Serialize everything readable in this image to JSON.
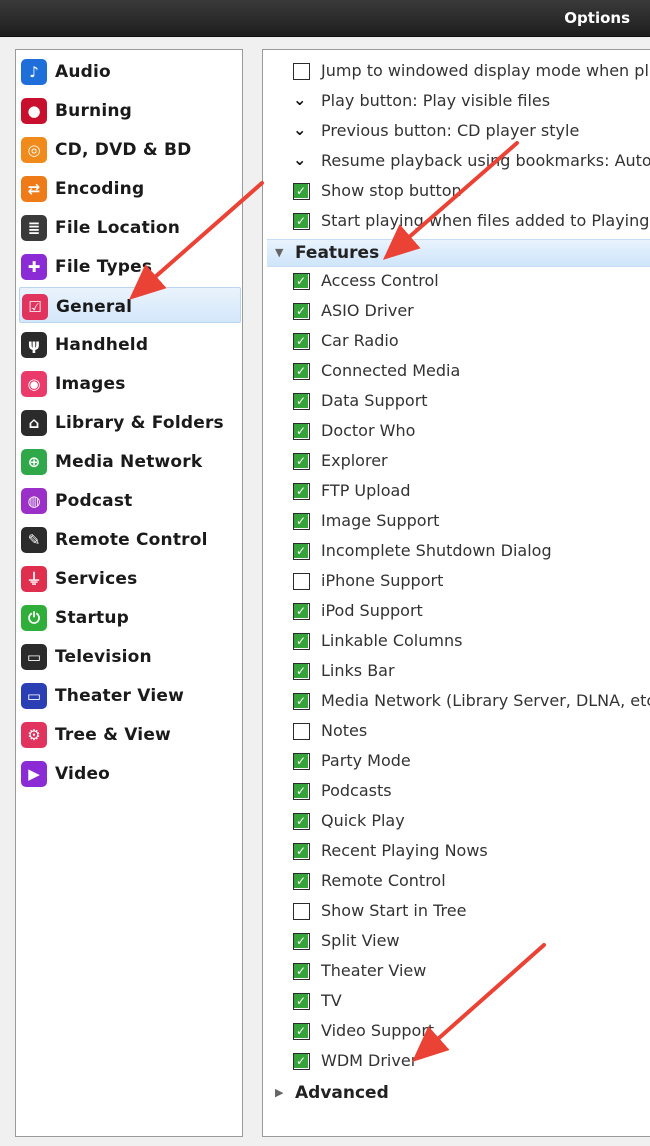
{
  "window": {
    "title": "Options"
  },
  "sidebar": {
    "selected": "General",
    "items": [
      {
        "label": "Audio",
        "icon": "music-note-icon",
        "color": "#1e6fd9",
        "glyph": "♪"
      },
      {
        "label": "Burning",
        "icon": "burn-disc-icon",
        "color": "#c8102e",
        "glyph": "●"
      },
      {
        "label": "CD, DVD & BD",
        "icon": "disc-icon",
        "color": "#f08a1a",
        "glyph": "◎"
      },
      {
        "label": "Encoding",
        "icon": "encoding-icon",
        "color": "#ef7a18",
        "glyph": "⇄"
      },
      {
        "label": "File Location",
        "icon": "file-location-icon",
        "color": "#3a3a3a",
        "glyph": "≣"
      },
      {
        "label": "File Types",
        "icon": "puzzle-icon",
        "color": "#8a2bd6",
        "glyph": "✚"
      },
      {
        "label": "General",
        "icon": "general-checkbox-icon",
        "color": "#e0335d",
        "glyph": "☑"
      },
      {
        "label": "Handheld",
        "icon": "usb-icon",
        "color": "#2b2b2b",
        "glyph": "ψ"
      },
      {
        "label": "Images",
        "icon": "camera-icon",
        "color": "#ea3a6a",
        "glyph": "◉"
      },
      {
        "label": "Library & Folders",
        "icon": "library-icon",
        "color": "#2b2b2b",
        "glyph": "⌂"
      },
      {
        "label": "Media Network",
        "icon": "network-icon",
        "color": "#2fa84a",
        "glyph": "⊕"
      },
      {
        "label": "Podcast",
        "icon": "podcast-icon",
        "color": "#9b30c9",
        "glyph": "◍"
      },
      {
        "label": "Remote Control",
        "icon": "remote-icon",
        "color": "#2b2b2b",
        "glyph": "✎"
      },
      {
        "label": "Services",
        "icon": "plug-icon",
        "color": "#e02e4f",
        "glyph": "⏚"
      },
      {
        "label": "Startup",
        "icon": "power-icon",
        "color": "#2fae3a",
        "glyph": "⏻"
      },
      {
        "label": "Television",
        "icon": "tv-icon",
        "color": "#2b2b2b",
        "glyph": "▭"
      },
      {
        "label": "Theater View",
        "icon": "monitor-icon",
        "color": "#2a3fb3",
        "glyph": "▭"
      },
      {
        "label": "Tree & View",
        "icon": "gear-icon",
        "color": "#e0335d",
        "glyph": "⚙"
      },
      {
        "label": "Video",
        "icon": "video-camera-icon",
        "color": "#8a2bd6",
        "glyph": "▶"
      }
    ]
  },
  "content": {
    "top_rows": [
      {
        "type": "checkbox",
        "checked": false,
        "label": "Jump to windowed display mode when pl"
      },
      {
        "type": "dropdown",
        "label": "Play button: Play visible files"
      },
      {
        "type": "dropdown",
        "label": "Previous button: CD player style"
      },
      {
        "type": "dropdown",
        "label": "Resume playback using bookmarks: Autor"
      },
      {
        "type": "checkbox",
        "checked": true,
        "label": "Show stop button"
      },
      {
        "type": "checkbox",
        "checked": true,
        "label": "Start playing when files added to Playing N"
      }
    ],
    "features_section": {
      "label": "Features",
      "expanded": true,
      "items": [
        {
          "label": "Access Control",
          "checked": true
        },
        {
          "label": "ASIO Driver",
          "checked": true
        },
        {
          "label": "Car Radio",
          "checked": true
        },
        {
          "label": "Connected Media",
          "checked": true
        },
        {
          "label": "Data Support",
          "checked": true
        },
        {
          "label": "Doctor Who",
          "checked": true
        },
        {
          "label": "Explorer",
          "checked": true
        },
        {
          "label": "FTP Upload",
          "checked": true
        },
        {
          "label": "Image Support",
          "checked": true
        },
        {
          "label": "Incomplete Shutdown Dialog",
          "checked": true
        },
        {
          "label": "iPhone Support",
          "checked": false
        },
        {
          "label": "iPod Support",
          "checked": true
        },
        {
          "label": "Linkable Columns",
          "checked": true
        },
        {
          "label": "Links Bar",
          "checked": true
        },
        {
          "label": "Media Network (Library Server, DLNA, etc.",
          "checked": true
        },
        {
          "label": "Notes",
          "checked": false
        },
        {
          "label": "Party Mode",
          "checked": true
        },
        {
          "label": "Podcasts",
          "checked": true
        },
        {
          "label": "Quick Play",
          "checked": true
        },
        {
          "label": "Recent Playing Nows",
          "checked": true
        },
        {
          "label": "Remote Control",
          "checked": true
        },
        {
          "label": "Show Start in Tree",
          "checked": false
        },
        {
          "label": "Split View",
          "checked": true
        },
        {
          "label": "Theater View",
          "checked": true
        },
        {
          "label": "TV",
          "checked": true
        },
        {
          "label": "Video Support",
          "checked": true
        },
        {
          "label": "WDM Driver",
          "checked": true
        }
      ]
    },
    "advanced_section": {
      "label": "Advanced",
      "expanded": false
    }
  },
  "annotations": {
    "arrow_color": "#ea4335"
  }
}
